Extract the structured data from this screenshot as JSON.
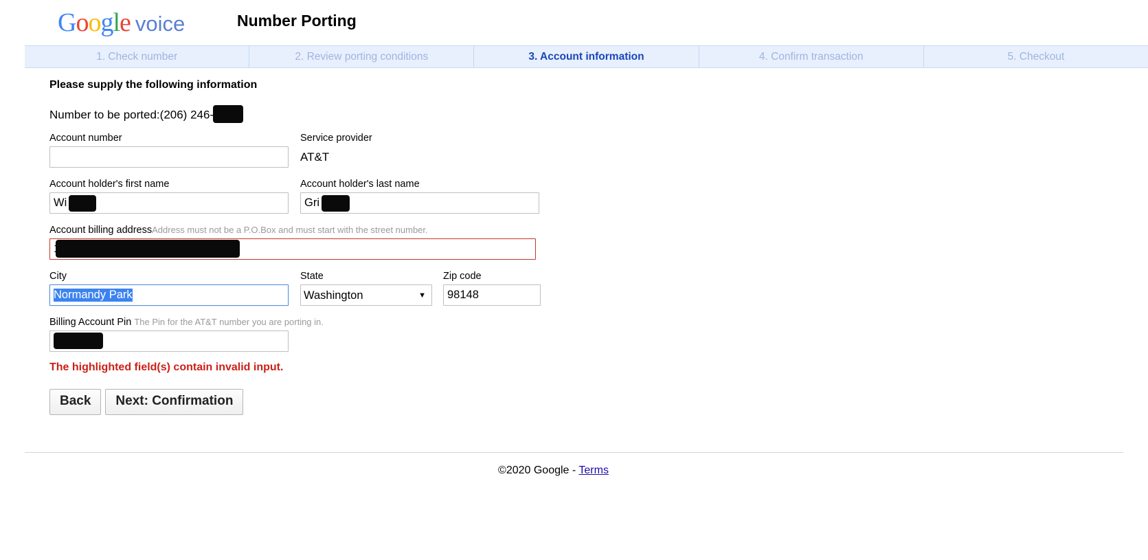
{
  "header": {
    "brand_google": "Google",
    "brand_product": "voice",
    "page_title": "Number Porting",
    "brand_colors": {
      "blue": "#4285f4",
      "red": "#ea4335",
      "yellow": "#fbbc05",
      "green": "#34a853",
      "voice_blue": "#5b7fd4"
    }
  },
  "steps": [
    {
      "label": "1. Check number",
      "active": false
    },
    {
      "label": "2. Review porting conditions",
      "active": false
    },
    {
      "label": "3. Account information",
      "active": true
    },
    {
      "label": "4. Confirm transaction",
      "active": false
    },
    {
      "label": "5. Checkout",
      "active": false
    }
  ],
  "form": {
    "heading": "Please supply the following information",
    "ported_number_label": "Number to be ported:",
    "ported_number_value": "(206) 246-",
    "ported_number_redacted": true,
    "fields": {
      "account_number": {
        "label": "Account number",
        "value": "",
        "placeholder": "",
        "invalid": true
      },
      "service_provider": {
        "label": "Service provider",
        "value": "AT&T"
      },
      "first_name": {
        "label": "Account holder's first name",
        "value": "Wi",
        "redacted": true,
        "invalid": false
      },
      "last_name": {
        "label": "Account holder's last name",
        "value": "Gri",
        "redacted": true,
        "invalid": false
      },
      "billing_address": {
        "label": "Account billing address",
        "hint": "Address must not be a P.O.Box and must start with the street number.",
        "value": "1",
        "redacted": true,
        "invalid": true
      },
      "city": {
        "label": "City",
        "value": "Normandy Park",
        "focused": true,
        "text_selected": true
      },
      "state": {
        "label": "State",
        "value": "Washington",
        "options": [
          "Washington"
        ]
      },
      "zip": {
        "label": "Zip code",
        "value": "98148"
      },
      "billing_pin": {
        "label": "Billing Account Pin",
        "hint": "The Pin for the AT&T number you are porting in.",
        "value": "",
        "redacted": true,
        "invalid": false
      }
    },
    "error_message": "The highlighted field(s) contain invalid input.",
    "error_color": "#cc2017",
    "buttons": {
      "back": "Back",
      "next": "Next: Confirmation"
    }
  },
  "footer": {
    "copyright": "©2020 Google - ",
    "terms_link": "Terms"
  }
}
